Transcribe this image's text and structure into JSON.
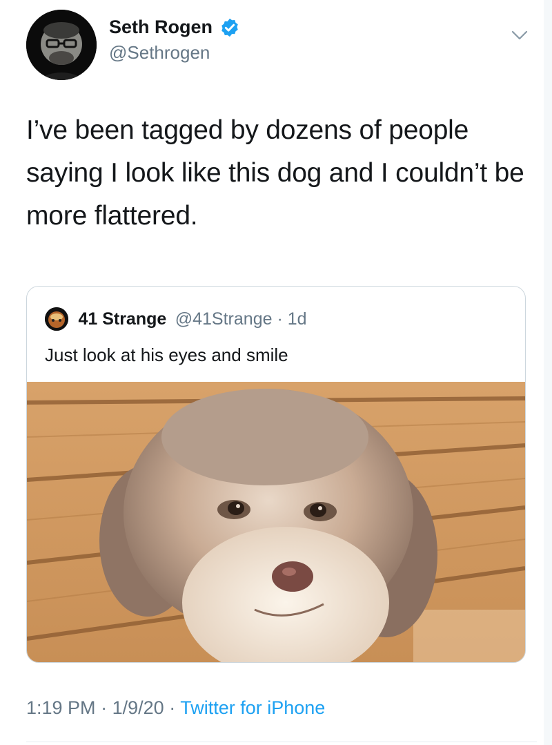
{
  "tweet": {
    "author": {
      "display_name": "Seth Rogen",
      "handle": "@Sethrogen",
      "verified": true,
      "avatar_icon": "profile-photo"
    },
    "text": "I’ve been tagged by dozens of people saying I look like this dog and I couldn’t be more flattered.",
    "menu_icon": "chevron-down-icon"
  },
  "quoted_tweet": {
    "author": {
      "display_name": "41 Strange",
      "handle": "@41Strange",
      "age": "1d",
      "avatar_icon": "profile-photo"
    },
    "text": "Just look at his eyes and smile",
    "media": {
      "kind": "photo",
      "subject": "dog-on-wooden-bench"
    }
  },
  "meta": {
    "time": "1:19 PM",
    "date": "1/9/20",
    "source": "Twitter for iPhone",
    "separator": "·"
  },
  "colors": {
    "primary_text": "#14171a",
    "secondary_text": "#657786",
    "link": "#1da1f2",
    "verified_badge": "#1da1f2",
    "border": "#ccd6dd"
  }
}
